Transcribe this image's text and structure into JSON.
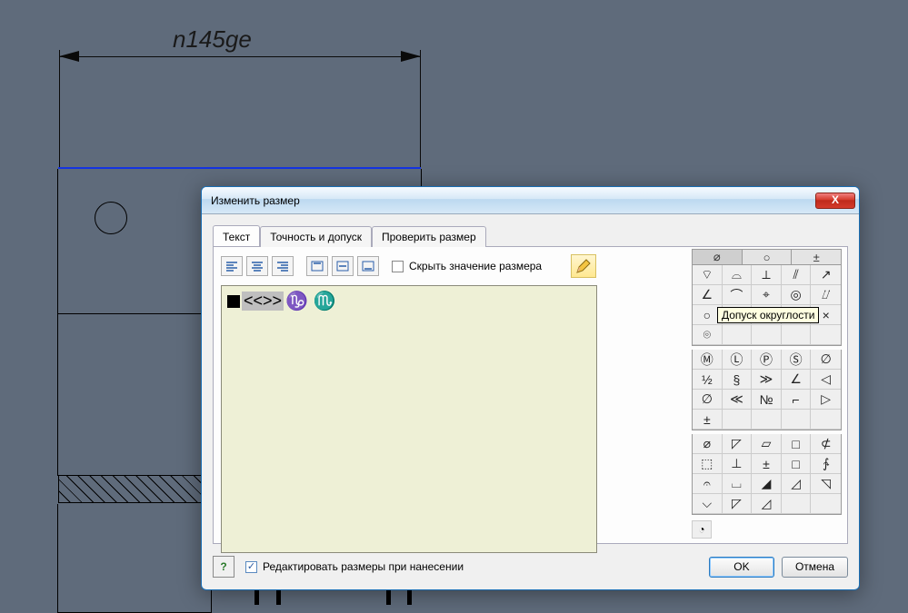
{
  "drawing": {
    "dimension_prefix": "n",
    "dimension_value": "145",
    "dimension_suffix": "ge"
  },
  "dialog": {
    "title": "Изменить размер",
    "close_glyph": "X",
    "tabs": [
      {
        "label": "Текст"
      },
      {
        "label": "Точность и допуск"
      },
      {
        "label": "Проверить размер"
      }
    ],
    "hide_value_label": "Скрыть значение размера",
    "text_content_token": "<<>>",
    "text_symbols": "♑ ♏",
    "tooltip": "Допуск округлости",
    "footer": {
      "edit_label": "Редактировать размеры при нанесении",
      "ok": "OK",
      "cancel": "Отмена",
      "help_glyph": "?"
    },
    "sym_tabs": {
      "a": "⌀",
      "b": "○",
      "c": "±"
    },
    "grid1": [
      "⌔",
      "⌓",
      "⟂",
      "⫽",
      "↗",
      "∠",
      "⌒",
      "⌖",
      "◎",
      "⌰",
      "○",
      "⌭",
      "=",
      "—",
      "×",
      "⌾",
      "",
      "",
      "",
      ""
    ],
    "grid2": [
      "Ⓜ",
      "Ⓛ",
      "Ⓟ",
      "Ⓢ",
      "∅",
      "½",
      "§",
      "≫",
      "∠",
      "◁",
      "∅",
      "≪",
      "№",
      "⌐",
      "▷",
      "±",
      "",
      "",
      "",
      ""
    ],
    "grid3": [
      "⌀",
      "◸",
      "▱",
      "□",
      "⊄",
      "⬚",
      "⊥",
      "±",
      "□",
      "∱",
      "𝄐",
      "⌴",
      "◢",
      "◿",
      "◹",
      "⌵",
      "◸",
      "◿",
      "",
      ""
    ],
    "protractor": "◔"
  }
}
